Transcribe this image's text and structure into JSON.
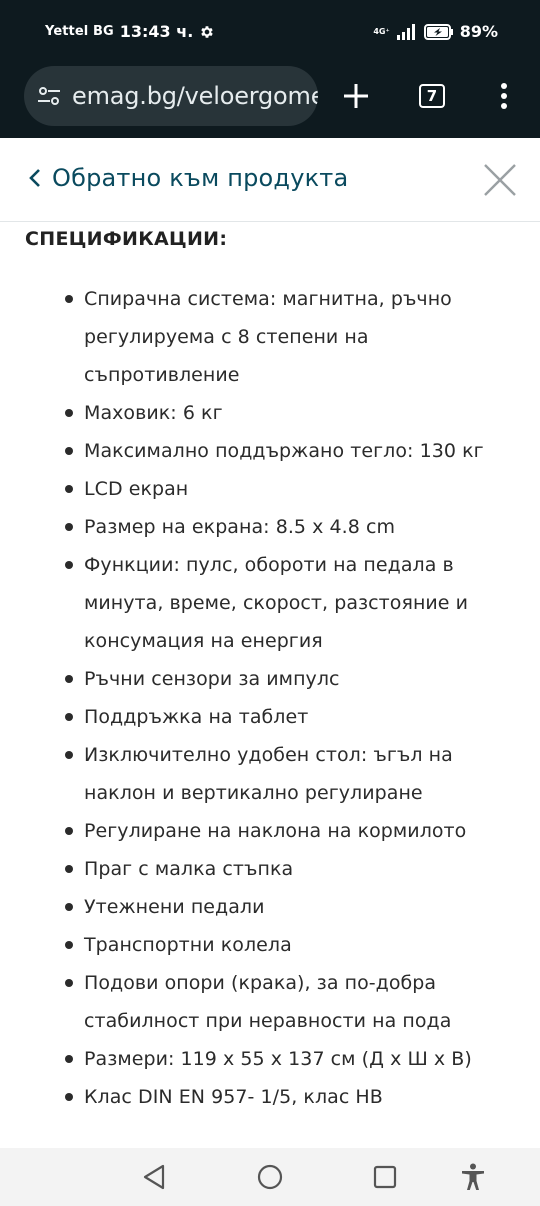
{
  "status_bar": {
    "carrier": "Yettel BG",
    "time": "13:43 ч.",
    "network_type": "4G⁺",
    "battery": "89%"
  },
  "browser": {
    "url": "emag.bg/veloergome",
    "tab_count": "7"
  },
  "page": {
    "back_label": "Обратно към продукта",
    "section_title": "СПЕЦИФИКАЦИИ:",
    "specs": [
      [
        "Спирачна система: магнитна, ръчно",
        "регулируема с 8 степени на",
        "съпротивление"
      ],
      [
        "Маховик: 6 кг"
      ],
      [
        "Максимално поддържано тегло: 130 кг"
      ],
      [
        "LCD екран"
      ],
      [
        "Размер на екрана: 8.5 x 4.8 cm"
      ],
      [
        "Функции: пулс, обороти на педала в",
        "минута, време, скорост, разстояние и",
        "консумация на енергия"
      ],
      [
        "Ръчни сензори за импулс"
      ],
      [
        "Поддръжка на таблет"
      ],
      [
        "Изключително удобен стол: ъгъл на",
        "наклон и вертикално регулиране"
      ],
      [
        "Регулиране на наклона на кормилото"
      ],
      [
        "Праг с малка стъпка"
      ],
      [
        "Утежнени педали"
      ],
      [
        "Транспортни колела"
      ],
      [
        "Подови опори (крака), за по-добра",
        "стабилност при неравности на пода"
      ],
      [
        "Размери: 119 x 55 x 137 см (Д x Ш x В)"
      ],
      [
        "Клас DIN EN 957- 1/5, клас HB"
      ]
    ]
  },
  "icons": {
    "settings": "gear-icon",
    "site_info": "tune-icon",
    "new_tab": "plus-icon",
    "menu": "more-vert-icon",
    "back": "chevron-left-icon",
    "close": "close-icon",
    "nav_back": "triangle-back-icon",
    "nav_home": "circle-home-icon",
    "nav_recents": "square-recents-icon",
    "accessibility": "accessibility-icon"
  },
  "colors": {
    "browser_chrome": "#0e1a1f",
    "url_bar": "#283439",
    "link": "#0a4a5e",
    "text": "#2b2b2b",
    "nav_bar": "#f3f3f3"
  }
}
